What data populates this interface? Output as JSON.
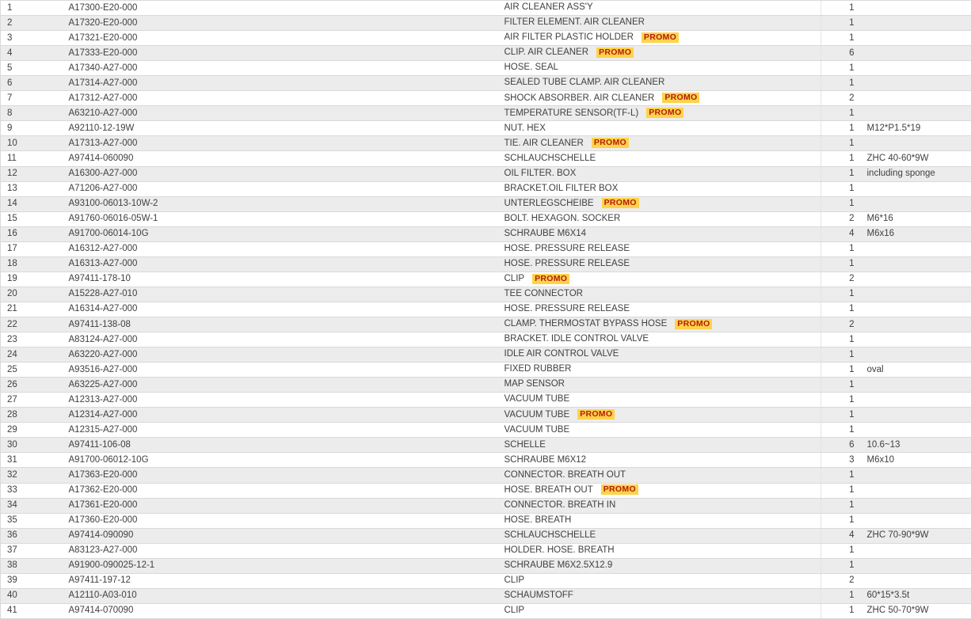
{
  "table": {
    "columns": [
      "no",
      "part_number",
      "description",
      "quantity",
      "remark"
    ],
    "promo_label": "PROMO",
    "promo_badge_color": "#ffd24a",
    "promo_text_color": "#b21d0c",
    "row_stripe_color": "#ececec",
    "row_base_color": "#ffffff",
    "border_color": "#d9d9d9",
    "text_color": "#404040",
    "rows": [
      {
        "no": "1",
        "part_number": "A17300-E20-000",
        "description": "AIR CLEANER ASS'Y",
        "promo": false,
        "quantity": "1",
        "remark": ""
      },
      {
        "no": "2",
        "part_number": "A17320-E20-000",
        "description": "FILTER ELEMENT. AIR CLEANER",
        "promo": false,
        "quantity": "1",
        "remark": ""
      },
      {
        "no": "3",
        "part_number": "A17321-E20-000",
        "description": "AIR FILTER PLASTIC HOLDER",
        "promo": true,
        "quantity": "1",
        "remark": ""
      },
      {
        "no": "4",
        "part_number": "A17333-E20-000",
        "description": "CLIP. AIR CLEANER",
        "promo": true,
        "quantity": "6",
        "remark": ""
      },
      {
        "no": "5",
        "part_number": "A17340-A27-000",
        "description": "HOSE. SEAL",
        "promo": false,
        "quantity": "1",
        "remark": ""
      },
      {
        "no": "6",
        "part_number": "A17314-A27-000",
        "description": "SEALED TUBE CLAMP. AIR CLEANER",
        "promo": false,
        "quantity": "1",
        "remark": ""
      },
      {
        "no": "7",
        "part_number": "A17312-A27-000",
        "description": "SHOCK ABSORBER. AIR CLEANER",
        "promo": true,
        "quantity": "2",
        "remark": ""
      },
      {
        "no": "8",
        "part_number": "A63210-A27-000",
        "description": "TEMPERATURE SENSOR(TF-L)",
        "promo": true,
        "quantity": "1",
        "remark": ""
      },
      {
        "no": "9",
        "part_number": "A92110-12-19W",
        "description": "NUT. HEX",
        "promo": false,
        "quantity": "1",
        "remark": "M12*P1.5*19"
      },
      {
        "no": "10",
        "part_number": "A17313-A27-000",
        "description": "TIE. AIR CLEANER",
        "promo": true,
        "quantity": "1",
        "remark": ""
      },
      {
        "no": "11",
        "part_number": "A97414-060090",
        "description": "SCHLAUCHSCHELLE",
        "promo": false,
        "quantity": "1",
        "remark": "ZHC 40-60*9W"
      },
      {
        "no": "12",
        "part_number": "A16300-A27-000",
        "description": "OIL FILTER. BOX",
        "promo": false,
        "quantity": "1",
        "remark": "including sponge"
      },
      {
        "no": "13",
        "part_number": "A71206-A27-000",
        "description": "BRACKET.OIL FILTER BOX",
        "promo": false,
        "quantity": "1",
        "remark": ""
      },
      {
        "no": "14",
        "part_number": "A93100-06013-10W-2",
        "description": "UNTERLEGSCHEIBE",
        "promo": true,
        "quantity": "1",
        "remark": ""
      },
      {
        "no": "15",
        "part_number": "A91760-06016-05W-1",
        "description": "BOLT. HEXAGON. SOCKER",
        "promo": false,
        "quantity": "2",
        "remark": "M6*16"
      },
      {
        "no": "16",
        "part_number": "A91700-06014-10G",
        "description": "SCHRAUBE M6X14",
        "promo": false,
        "quantity": "4",
        "remark": "M6x16"
      },
      {
        "no": "17",
        "part_number": "A16312-A27-000",
        "description": "HOSE. PRESSURE RELEASE",
        "promo": false,
        "quantity": "1",
        "remark": ""
      },
      {
        "no": "18",
        "part_number": "A16313-A27-000",
        "description": "HOSE. PRESSURE RELEASE",
        "promo": false,
        "quantity": "1",
        "remark": ""
      },
      {
        "no": "19",
        "part_number": "A97411-178-10",
        "description": "CLIP",
        "promo": true,
        "quantity": "2",
        "remark": ""
      },
      {
        "no": "20",
        "part_number": "A15228-A27-010",
        "description": "TEE CONNECTOR",
        "promo": false,
        "quantity": "1",
        "remark": ""
      },
      {
        "no": "21",
        "part_number": "A16314-A27-000",
        "description": "HOSE. PRESSURE RELEASE",
        "promo": false,
        "quantity": "1",
        "remark": ""
      },
      {
        "no": "22",
        "part_number": "A97411-138-08",
        "description": "CLAMP. THERMOSTAT BYPASS HOSE",
        "promo": true,
        "quantity": "2",
        "remark": ""
      },
      {
        "no": "23",
        "part_number": "A83124-A27-000",
        "description": "BRACKET. IDLE CONTROL VALVE",
        "promo": false,
        "quantity": "1",
        "remark": ""
      },
      {
        "no": "24",
        "part_number": "A63220-A27-000",
        "description": "IDLE AIR CONTROL VALVE",
        "promo": false,
        "quantity": "1",
        "remark": ""
      },
      {
        "no": "25",
        "part_number": "A93516-A27-000",
        "description": "FIXED RUBBER",
        "promo": false,
        "quantity": "1",
        "remark": "oval"
      },
      {
        "no": "26",
        "part_number": "A63225-A27-000",
        "description": "MAP SENSOR",
        "promo": false,
        "quantity": "1",
        "remark": ""
      },
      {
        "no": "27",
        "part_number": "A12313-A27-000",
        "description": "VACUUM TUBE",
        "promo": false,
        "quantity": "1",
        "remark": ""
      },
      {
        "no": "28",
        "part_number": "A12314-A27-000",
        "description": "VACUUM TUBE",
        "promo": true,
        "quantity": "1",
        "remark": ""
      },
      {
        "no": "29",
        "part_number": "A12315-A27-000",
        "description": "VACUUM TUBE",
        "promo": false,
        "quantity": "1",
        "remark": ""
      },
      {
        "no": "30",
        "part_number": "A97411-106-08",
        "description": "SCHELLE",
        "promo": false,
        "quantity": "6",
        "remark": "10.6~13"
      },
      {
        "no": "31",
        "part_number": "A91700-06012-10G",
        "description": "SCHRAUBE M6X12",
        "promo": false,
        "quantity": "3",
        "remark": "M6x10"
      },
      {
        "no": "32",
        "part_number": "A17363-E20-000",
        "description": "CONNECTOR. BREATH OUT",
        "promo": false,
        "quantity": "1",
        "remark": ""
      },
      {
        "no": "33",
        "part_number": "A17362-E20-000",
        "description": "HOSE. BREATH OUT",
        "promo": true,
        "quantity": "1",
        "remark": ""
      },
      {
        "no": "34",
        "part_number": "A17361-E20-000",
        "description": "CONNECTOR. BREATH IN",
        "promo": false,
        "quantity": "1",
        "remark": ""
      },
      {
        "no": "35",
        "part_number": "A17360-E20-000",
        "description": "HOSE. BREATH",
        "promo": false,
        "quantity": "1",
        "remark": ""
      },
      {
        "no": "36",
        "part_number": "A97414-090090",
        "description": "SCHLAUCHSCHELLE",
        "promo": false,
        "quantity": "4",
        "remark": "ZHC 70-90*9W"
      },
      {
        "no": "37",
        "part_number": "A83123-A27-000",
        "description": "HOLDER. HOSE. BREATH",
        "promo": false,
        "quantity": "1",
        "remark": ""
      },
      {
        "no": "38",
        "part_number": "A91900-090025-12-1",
        "description": "SCHRAUBE M6X2.5X12.9",
        "promo": false,
        "quantity": "1",
        "remark": ""
      },
      {
        "no": "39",
        "part_number": "A97411-197-12",
        "description": "CLIP",
        "promo": false,
        "quantity": "2",
        "remark": ""
      },
      {
        "no": "40",
        "part_number": "A12110-A03-010",
        "description": "SCHAUMSTOFF",
        "promo": false,
        "quantity": "1",
        "remark": "60*15*3.5t"
      },
      {
        "no": "41",
        "part_number": "A97414-070090",
        "description": "CLIP",
        "promo": false,
        "quantity": "1",
        "remark": "ZHC 50-70*9W"
      }
    ]
  }
}
